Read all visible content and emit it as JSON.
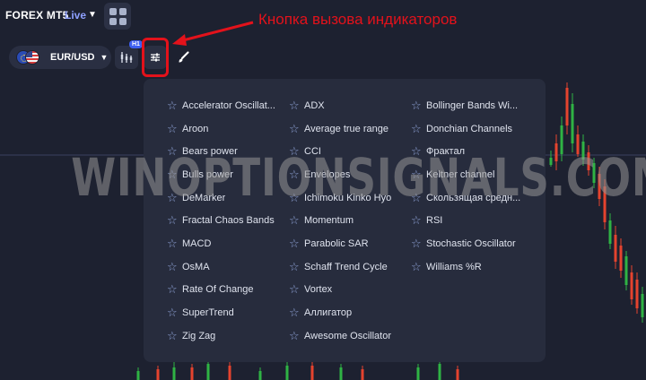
{
  "header": {
    "app_title": "FOREX MT5",
    "live_label": "Live",
    "grid_icon": "grid-icon"
  },
  "toolbar": {
    "pair_label": "EUR/USD",
    "timeframe_badge": "H1",
    "icons": [
      "candles-icon",
      "sliders-icon",
      "brush-icon"
    ]
  },
  "annotation": {
    "text": "Кнопка вызова индикаторов",
    "color": "#e3121b"
  },
  "watermark": {
    "text": "WINOPTIONSIGNALS.COM"
  },
  "indicators": [
    "Accelerator Oscillat...",
    "Aroon",
    "Bears power",
    "Bulls power",
    "DeMarker",
    "Fractal Chaos Bands",
    "MACD",
    "OsMA",
    "Rate Of Change",
    "SuperTrend",
    "Zig Zag",
    "ADX",
    "Average true range",
    "CCI",
    "Envelopes",
    "Ichimoku Kinko Hyo",
    "Momentum",
    "Parabolic SAR",
    "Schaff Trend Cycle",
    "Vortex",
    "Аллигатор",
    "Awesome Oscillator",
    "Bollinger Bands Wi...",
    "Donchian Channels",
    "Фрактал",
    "Keltner channel",
    "Скользящая средн...",
    "RSI",
    "Stochastic Oscillator",
    "Williams %R"
  ],
  "colors": {
    "background": "#1d2130",
    "panel": "#272c3d",
    "bull": "#2fb344",
    "bear": "#e5432e",
    "accent": "#3c5ef0"
  }
}
